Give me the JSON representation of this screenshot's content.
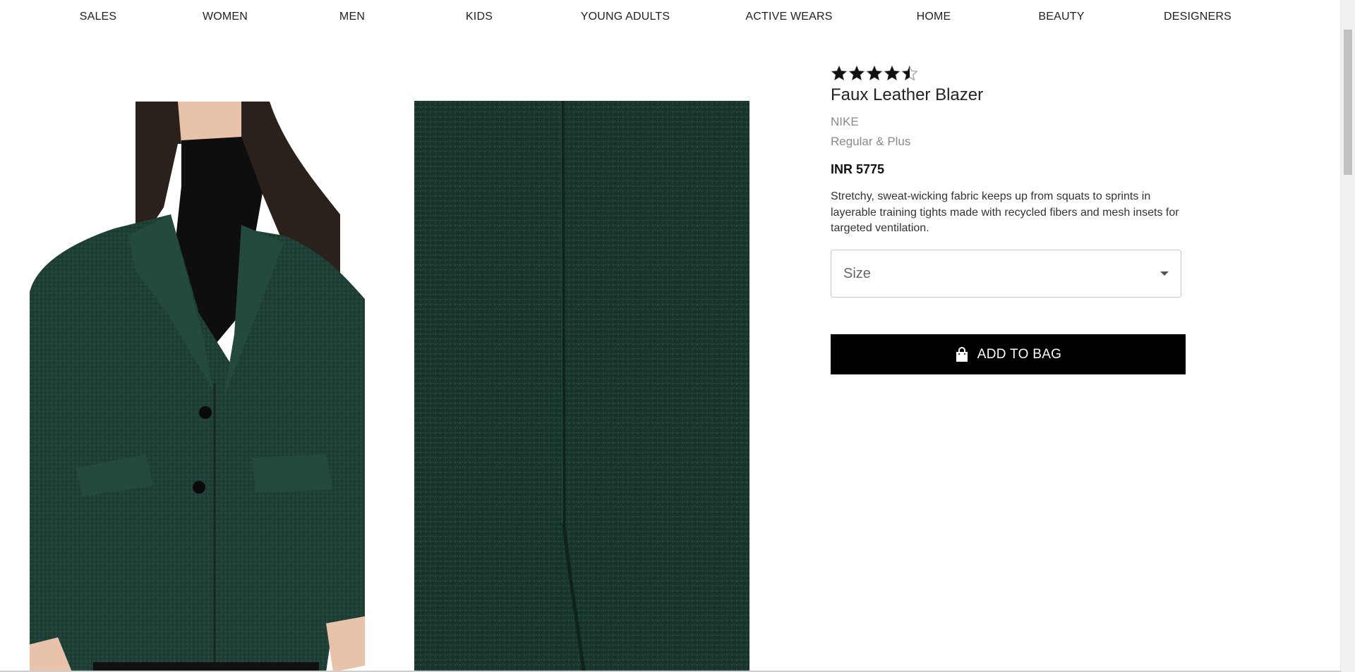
{
  "nav": {
    "items": [
      "SALES",
      "WOMEN",
      "MEN",
      "KIDS",
      "YOUNG ADULTS",
      "ACTIVE WEARS",
      "HOME",
      "BEAUTY",
      "DESIGNERS"
    ]
  },
  "product": {
    "rating": 4.5,
    "rating_max": 5,
    "title": "Faux Leather Blazer",
    "brand": "NIKE",
    "fit": "Regular & Plus",
    "price": "INR 5775",
    "description": "Stretchy, sweat-wicking fabric keeps up from squats to sprints in layerable training tights made with recycled fibers and mesh insets for targeted ventilation.",
    "size_placeholder": "Size",
    "add_to_bag_label": "ADD TO BAG",
    "images": [
      {
        "icon": "model-photo-green-blazer"
      },
      {
        "icon": "fabric-closeup-green-wool"
      }
    ]
  },
  "colors": {
    "coat_green": "#1d3d34",
    "button_black": "#000000"
  }
}
